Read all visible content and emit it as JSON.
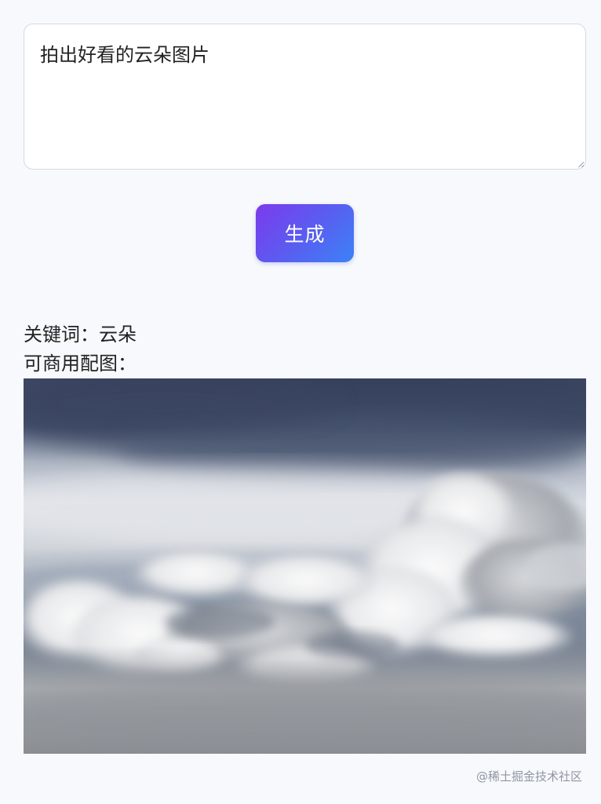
{
  "prompt": {
    "value": "拍出好看的云朵图片"
  },
  "generate_button": {
    "label": "生成"
  },
  "result": {
    "keyword_label": "关键词：",
    "keyword_value": "云朵",
    "image_label": "可商用配图："
  },
  "watermark": {
    "text": "@稀土掘金技术社区"
  },
  "colors": {
    "page_background": "#f7f9fc",
    "button_gradient_start": "#7c3aed",
    "button_gradient_end": "#3b82f6",
    "text": "#222222"
  }
}
